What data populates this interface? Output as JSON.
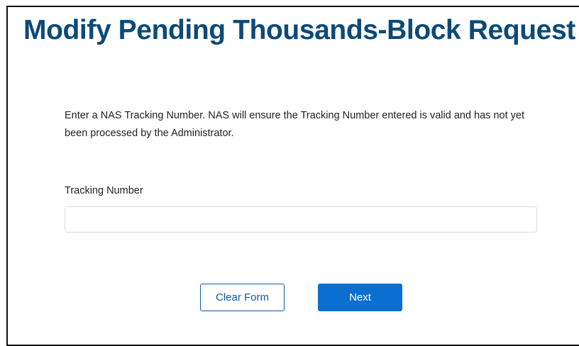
{
  "page": {
    "title": "Modify Pending Thousands-Block Request",
    "instructions": "Enter a NAS Tracking Number. NAS will ensure the Tracking Number entered is valid and has not yet been processed by the Administrator."
  },
  "form": {
    "tracking_number_label": "Tracking Number",
    "tracking_number_value": "",
    "tracking_number_placeholder": ""
  },
  "actions": {
    "clear_label": "Clear Form",
    "next_label": "Next"
  },
  "colors": {
    "title": "#0b4a78",
    "primary": "#0a6fd0",
    "secondary_border": "#0b5ea8"
  }
}
